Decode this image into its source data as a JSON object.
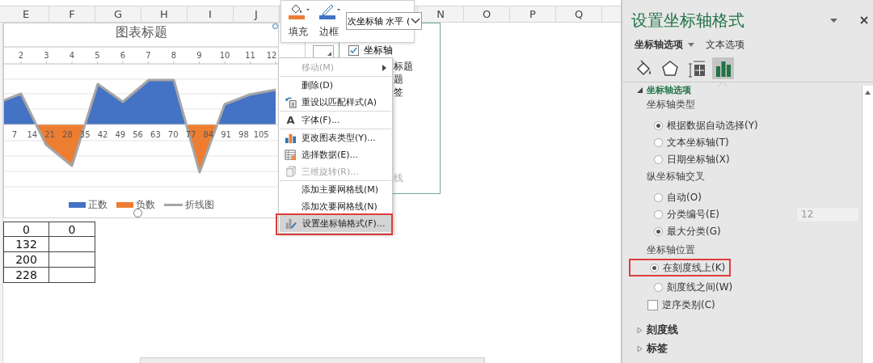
{
  "sheet": {
    "column_headers": [
      "E",
      "F",
      "G",
      "H",
      "I",
      "J"
    ],
    "column_headers_right": [
      "N",
      "O",
      "P",
      "Q"
    ],
    "rows": [
      {
        "column_e": "0",
        "column_f": "0"
      },
      {
        "column_e": "132"
      },
      {
        "column_e": "200"
      },
      {
        "column_e": "228"
      }
    ]
  },
  "chart": {
    "title": "图表标题",
    "top_axis_labels": [
      "2",
      "3",
      "4",
      "5",
      "6",
      "7",
      "8",
      "9",
      "10",
      "11",
      "12"
    ],
    "bottom_axis_labels": [
      "7",
      "14",
      "21",
      "28",
      "35",
      "42",
      "49",
      "56",
      "63",
      "70",
      "77",
      "84",
      "91",
      "98",
      "105"
    ],
    "legend": [
      {
        "label": "正数",
        "kind": "area",
        "color": "#4472c4"
      },
      {
        "label": "负数",
        "kind": "area",
        "color": "#ed7d31"
      },
      {
        "label": "折线图",
        "kind": "line",
        "color": "#a5a5a5"
      }
    ]
  },
  "mini_toolbar": {
    "fill_label": "填充",
    "border_label": "边框",
    "element_select": "次坐标轴 水平 ("
  },
  "elements_flyout": {
    "checkbox": {
      "label": "坐标轴",
      "checked": true
    },
    "fragments": [
      {
        "text": "标题",
        "disabled": false
      },
      {
        "text": "题",
        "disabled": false
      },
      {
        "text": "签",
        "disabled": false
      },
      {
        "text": "线",
        "disabled": true
      }
    ]
  },
  "context_menu": [
    {
      "label": "移动(M)",
      "kind": "plain",
      "disabled": true,
      "submenu": true,
      "separator_after": true,
      "selected": false,
      "highlighted": false
    },
    {
      "label": "删除(D)",
      "kind": "plain",
      "disabled": false,
      "submenu": false,
      "separator_after": false,
      "selected": false,
      "highlighted": false
    },
    {
      "label": "重设以匹配样式(A)",
      "kind": "reset",
      "disabled": false,
      "submenu": false,
      "separator_after": true,
      "selected": false,
      "highlighted": false
    },
    {
      "label": "字体(F)...",
      "kind": "font",
      "icon_text": "A",
      "disabled": false,
      "submenu": false,
      "separator_after": true,
      "selected": false,
      "highlighted": false
    },
    {
      "label": "更改图表类型(Y)...",
      "kind": "chart_type",
      "disabled": false,
      "submenu": false,
      "separator_after": false,
      "selected": false,
      "highlighted": false
    },
    {
      "label": "选择数据(E)...",
      "kind": "select_data",
      "disabled": false,
      "submenu": false,
      "separator_after": false,
      "selected": false,
      "highlighted": false
    },
    {
      "label": "三维旋转(R)...",
      "kind": "rotate_3d",
      "disabled": true,
      "submenu": false,
      "separator_after": true,
      "selected": false,
      "highlighted": false
    },
    {
      "label": "添加主要网格线(M)",
      "kind": "plain",
      "disabled": false,
      "submenu": false,
      "separator_after": false,
      "selected": false,
      "highlighted": false
    },
    {
      "label": "添加次要网格线(N)",
      "kind": "plain",
      "disabled": false,
      "submenu": false,
      "separator_after": false,
      "selected": false,
      "highlighted": false
    },
    {
      "label": "设置坐标轴格式(F)...",
      "kind": "format_axis",
      "disabled": false,
      "submenu": false,
      "separator_after": false,
      "selected": true,
      "highlighted": true
    }
  ],
  "format_pane": {
    "title": "设置坐标轴格式",
    "tabs": [
      {
        "label": "坐标轴选项",
        "selected": true
      },
      {
        "label": "文本选项",
        "selected": false
      }
    ],
    "icon_tabs": [
      {
        "kind": "fill",
        "selected": false
      },
      {
        "kind": "effects",
        "selected": false
      },
      {
        "kind": "size",
        "selected": false
      },
      {
        "kind": "axis",
        "selected": true
      }
    ],
    "section": {
      "title": "坐标轴选项",
      "expanded": true,
      "groups": [
        {
          "heading": "坐标轴类型",
          "items": [
            {
              "kind": "radio",
              "label": "根据数据自动选择(Y)",
              "selected": true,
              "highlighted": false
            },
            {
              "kind": "radio",
              "label": "文本坐标轴(T)",
              "selected": false,
              "highlighted": false
            },
            {
              "kind": "radio",
              "label": "日期坐标轴(X)",
              "selected": false,
              "highlighted": false
            }
          ]
        },
        {
          "heading": "纵坐标轴交叉",
          "items": [
            {
              "kind": "radio",
              "label": "自动(O)",
              "selected": false,
              "highlighted": false
            },
            {
              "kind": "radio",
              "label": "分类编号(E)",
              "selected": false,
              "highlighted": false,
              "value": "12"
            },
            {
              "kind": "radio",
              "label": "最大分类(G)",
              "selected": true,
              "highlighted": false
            }
          ]
        },
        {
          "heading": "坐标轴位置",
          "items": [
            {
              "kind": "radio",
              "label": "在刻度线上(K)",
              "selected": true,
              "highlighted": true
            },
            {
              "kind": "radio",
              "label": "刻度线之间(W)",
              "selected": false,
              "highlighted": false
            },
            {
              "kind": "checkbox",
              "label": "逆序类别(C)",
              "checked": false
            }
          ]
        }
      ]
    },
    "collapsed_sections": [
      {
        "title": "刻度线",
        "expanded": false
      },
      {
        "title": "标签",
        "expanded": false
      }
    ]
  }
}
